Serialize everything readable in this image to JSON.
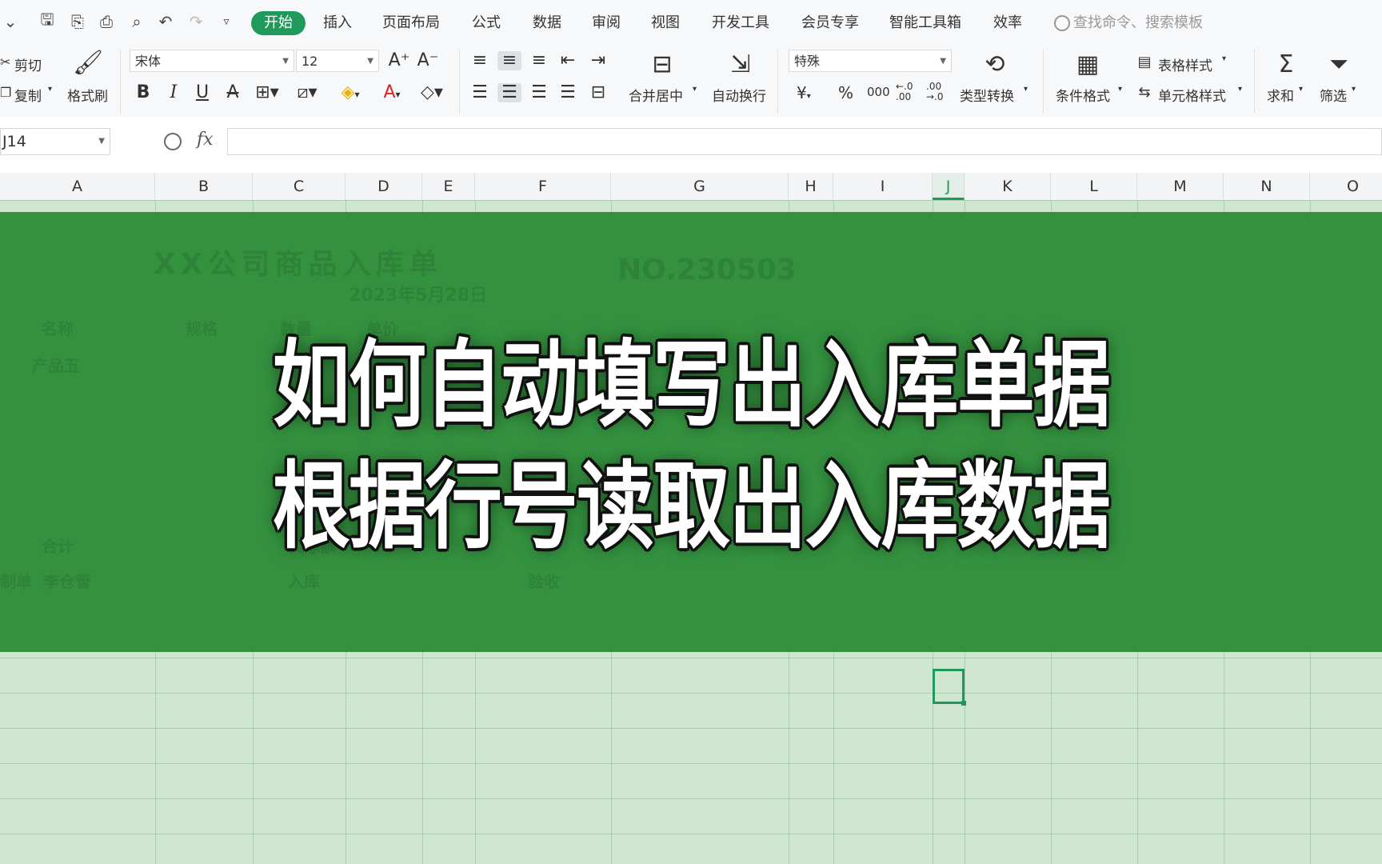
{
  "menu": {
    "items": [
      "开始",
      "插入",
      "页面布局",
      "公式",
      "数据",
      "审阅",
      "视图",
      "开发工具",
      "会员专享",
      "智能工具箱",
      "效率"
    ],
    "active": "开始",
    "search_placeholder": "查找命令、搜索模板"
  },
  "ribbon": {
    "cut": "剪切",
    "copy": "复制",
    "format_painter": "格式刷",
    "font_name": "宋体",
    "font_size": "12",
    "merge_center": "合并居中",
    "wrap_text": "自动换行",
    "number_format": "特殊",
    "currency": "¥",
    "percent": "%",
    "thousands": "000",
    "inc_decimal": "←.0\n.00",
    "dec_decimal": ".00\n→.0",
    "type_convert": "类型转换",
    "conditional_format": "条件格式",
    "table_style": "表格样式",
    "cell_style": "单元格样式",
    "sum": "求和",
    "filter": "筛选"
  },
  "formula_bar": {
    "cell_ref": "J14",
    "fx": "fx",
    "formula": ""
  },
  "columns": [
    "A",
    "B",
    "C",
    "D",
    "E",
    "F",
    "G",
    "H",
    "I",
    "J",
    "K",
    "L",
    "M",
    "N",
    "O"
  ],
  "selected_column": "J",
  "sheet_ghost": {
    "title": "XX公司商品入库单",
    "number": "NO.230503",
    "date": "2023年5月28日",
    "header_name": "名称",
    "header_spec": "规格",
    "header_qty": "数量",
    "header_price": "单价",
    "row1": "产品五",
    "total": "合计",
    "actual_amount": "实际额",
    "maker_label": "制单",
    "maker": "李仓管",
    "stock_in": "入库",
    "accept": "验收"
  },
  "overlay": {
    "line1": "如何自动填写出入库单据",
    "line2": "根据行号读取出入库数据"
  }
}
